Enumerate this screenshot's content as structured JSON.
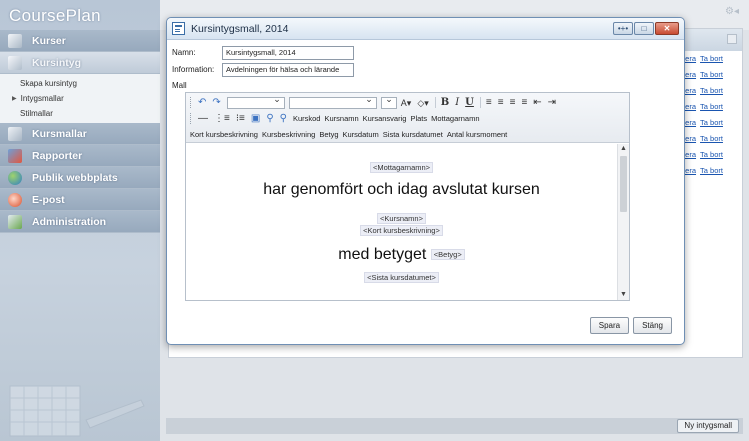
{
  "app": {
    "logo": "CoursePlan"
  },
  "sidebar": {
    "items": [
      {
        "label": "Kurser"
      },
      {
        "label": "Kursintyg"
      },
      {
        "label": "Kursmallar"
      },
      {
        "label": "Rapporter"
      },
      {
        "label": "Publik webbplats"
      },
      {
        "label": "E-post"
      },
      {
        "label": "Administration"
      }
    ],
    "subitems": [
      {
        "label": "Skapa kursintyg"
      },
      {
        "label": "Intygsmallar"
      },
      {
        "label": "Stilmallar"
      }
    ]
  },
  "background": {
    "row_links": {
      "edit": "edigera",
      "delete": "Ta bort"
    },
    "footer": {
      "new_cert_label": "Ny intygsmall"
    }
  },
  "dialog": {
    "title": "Kursintygsmall, 2014",
    "name_label": "Namn:",
    "name_value": "Kursintygsmall, 2014",
    "info_label": "Information:",
    "info_value": "Avdelningen för hälsa och lärande",
    "template_label": "Mall",
    "toolbar": {
      "fields_row2": [
        "Kurskod",
        "Kursnamn",
        "Kursansvarig",
        "Plats",
        "Mottagarnamn"
      ],
      "fields_row3": [
        "Kort kursbeskrivning",
        "Kursbeskrivning",
        "Betyg",
        "Kursdatum",
        "Sista kursdatumet",
        "Antal kursmoment"
      ]
    },
    "document": {
      "tag_recipient": "<Mottagarnamn>",
      "line1": "har genomfört och idag avslutat kursen",
      "tag_course": "<Kursnamn>",
      "tag_short_desc": "<Kort kursbeskrivning>",
      "line2": "med betyget",
      "tag_grade": "<Betyg>",
      "tag_last_date": "<Sista kursdatumet>"
    },
    "save_label": "Spara",
    "close_label": "Stäng"
  }
}
